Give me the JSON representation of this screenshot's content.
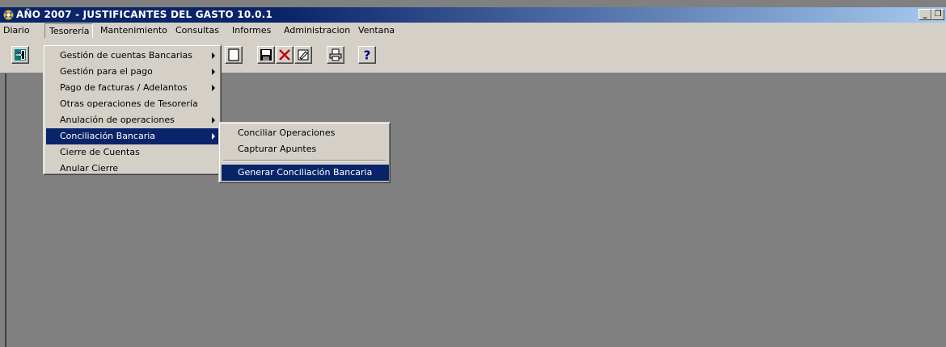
{
  "window": {
    "title": "AÑO 2007 - JUSTIFICANTES DEL GASTO 10.0.1",
    "app_icon": "app-icon",
    "buttons": {
      "minimize": "_",
      "restore": "❐"
    }
  },
  "menubar": {
    "items": [
      "Diario",
      "Tesorería",
      "Mantenimiento",
      "Consultas",
      "Informes",
      "Administracion",
      "Ventana"
    ],
    "open_item": "Tesorería"
  },
  "toolbar": {
    "buttons": [
      {
        "name": "exit-icon"
      },
      {
        "name": "new-document-icon"
      },
      {
        "name": "save-icon"
      },
      {
        "name": "delete-icon"
      },
      {
        "name": "edit-icon"
      },
      {
        "name": "print-icon"
      },
      {
        "name": "help-icon",
        "glyph": "?"
      }
    ]
  },
  "tesoreria_menu": {
    "items": [
      {
        "label": "Gestión de cuentas Bancarias",
        "submenu": true
      },
      {
        "label": "Gestión para el pago",
        "submenu": true
      },
      {
        "label": "Pago de facturas / Adelantos",
        "submenu": true
      },
      {
        "label": "Otras operaciones de Tesorería",
        "submenu": false
      },
      {
        "label": "Anulación de operaciones",
        "submenu": true
      },
      {
        "label": "Conciliación Bancaria",
        "submenu": true,
        "selected": true
      },
      {
        "label": "Cierre de Cuentas",
        "submenu": false
      },
      {
        "label": "Anular Cierre",
        "submenu": false
      }
    ]
  },
  "conciliacion_submenu": {
    "items": [
      {
        "label": "Conciliar Operaciones"
      },
      {
        "label": "Capturar Apuntes"
      },
      {
        "label": "Generar Conciliación Bancaria",
        "selected": true
      }
    ]
  },
  "colors": {
    "titlebar": "#0a246a",
    "highlight": "#0a246a",
    "face": "#d4d0c8",
    "workspace": "#808080"
  }
}
